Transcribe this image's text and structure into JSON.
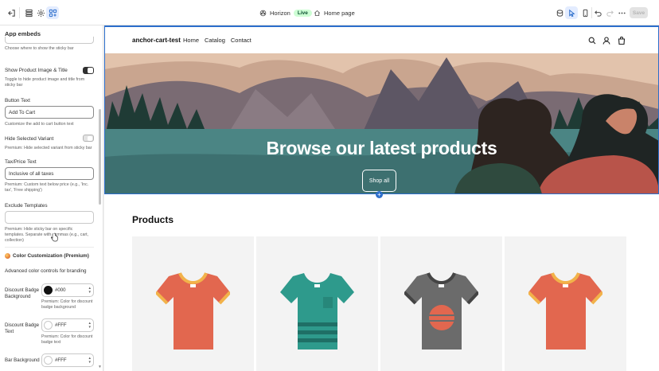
{
  "topbar": {
    "theme_name": "Horizon",
    "theme_status": "Live",
    "page_selector": "Home page",
    "save_label": "Save"
  },
  "sidebar": {
    "title": "App embeds",
    "position_help": "Choose where to show the sticky bar",
    "show_image": {
      "label": "Show Product Image & Title",
      "on": true,
      "help": "Toggle to hide product image and title from sticky bar"
    },
    "button_text": {
      "label": "Button Text",
      "value": "Add To Cart",
      "help": "Customize the add to cart button text"
    },
    "hide_variant": {
      "label": "Hide Selected Variant",
      "on": false,
      "help": "Premium: Hide selected variant from sticky bar"
    },
    "tax_price": {
      "label": "Tax/Price Text",
      "value": "Inclusive of all taxes",
      "help": "Premium: Custom text below price (e.g., 'Inc. tax', 'Free shipping')"
    },
    "exclude_templates": {
      "label": "Exclude Templates",
      "value": "",
      "help": "Premium: Hide sticky bar on specific templates. Separate with commas (e.g., cart, collection)"
    },
    "color_section": {
      "title": "Color Customization (Premium)",
      "desc": "Advanced color controls for branding"
    },
    "discount_badge_bg": {
      "label": "Discount Badge Background",
      "value": "#000",
      "swatch": "#111111",
      "help": "Premium: Color for discount badge background"
    },
    "discount_badge_text": {
      "label": "Discount Badge Text",
      "value": "#FFF",
      "swatch": "#ffffff",
      "help": "Premium: Color for discount badge text"
    },
    "bar_background": {
      "label": "Bar Background",
      "value": "#FFF",
      "swatch": "#ffffff"
    }
  },
  "preview": {
    "store_name": "anchor-cart-test",
    "nav": [
      "Home",
      "Catalog",
      "Contact"
    ],
    "hero_title": "Browse our latest products",
    "hero_button": "Shop all",
    "products_title": "Products",
    "products": [
      {
        "color": "#e2674f",
        "trim": "#f2b24a"
      },
      {
        "color": "#2e9a8c",
        "trim": "#1f6f66"
      },
      {
        "color": "#6b6b6b",
        "trim": "#444444"
      },
      {
        "color": "#e2674f",
        "trim": "#f2b24a"
      }
    ]
  }
}
